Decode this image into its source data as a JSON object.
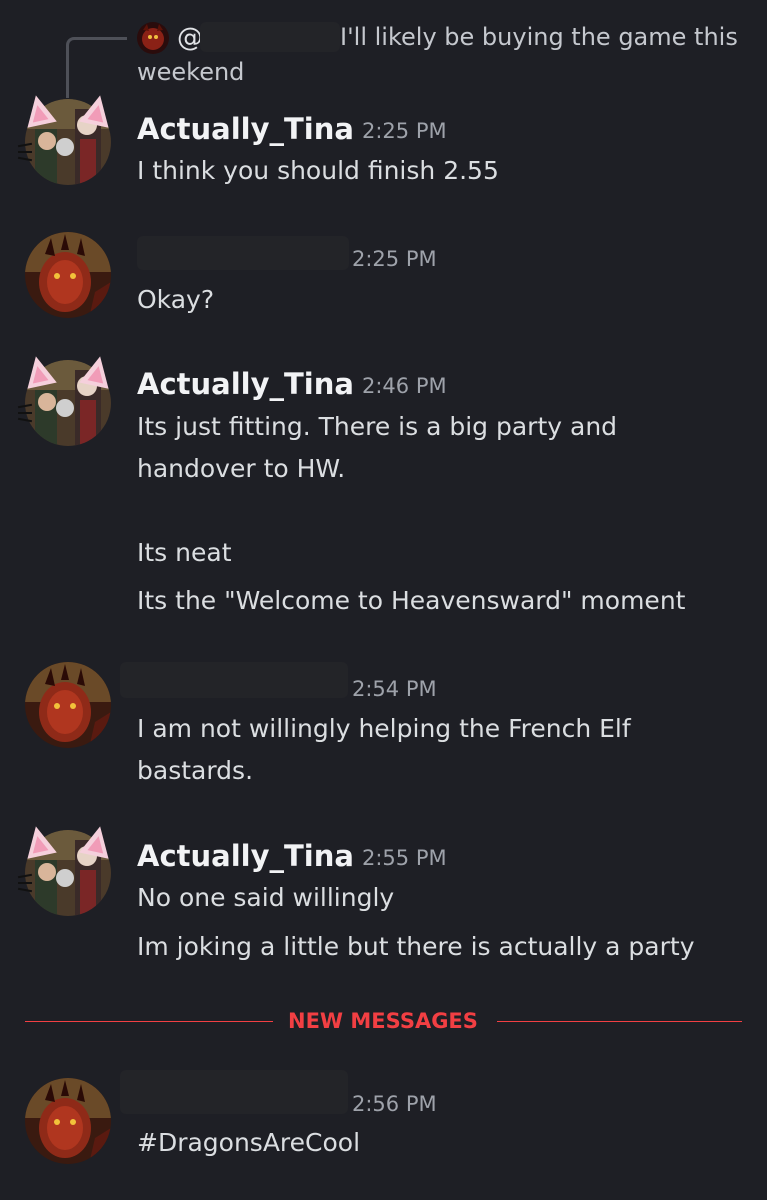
{
  "reply": {
    "at_symbol": "@",
    "text_line1": "I'll likely be buying the game this",
    "text_line2": "weekend"
  },
  "messages": [
    {
      "author": "Actually_Tina",
      "time": "2:25 PM",
      "lines": [
        "I think you should finish 2.55"
      ]
    },
    {
      "author": "",
      "time": "2:25 PM",
      "lines": [
        "Okay?"
      ]
    },
    {
      "author": "Actually_Tina",
      "time": "2:46 PM",
      "lines": [
        "Its just fitting. There is a big party and",
        "handover to HW.",
        "Its neat",
        "Its the \"Welcome to Heavensward\" moment"
      ]
    },
    {
      "author": "",
      "time": "2:54 PM",
      "lines": [
        "I am not willingly helping the French Elf",
        "bastards."
      ]
    },
    {
      "author": "Actually_Tina",
      "time": "2:55 PM",
      "lines": [
        "No one said willingly",
        "Im joking a little but there is actually a party"
      ]
    },
    {
      "author": "",
      "time": "2:56 PM",
      "lines": [
        "#DragonsAreCool"
      ]
    }
  ],
  "divider": {
    "label": "NEW MESSAGES"
  },
  "colors": {
    "background": "#1e1f25",
    "author": "#f2f3f5",
    "timestamp": "#9ea2aa",
    "message_text": "#dbdee1",
    "new_messages": "#f23f43"
  }
}
